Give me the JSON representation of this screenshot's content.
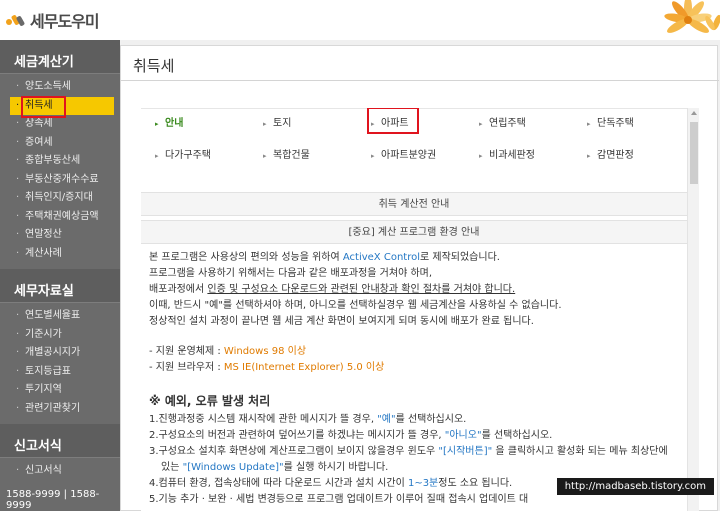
{
  "header": {
    "logo_text": "세무도우미"
  },
  "sidebar": {
    "sections": [
      {
        "title": "세금계산기",
        "items": [
          "양도소득세",
          "취득세",
          "상속세",
          "증여세",
          "종합부동산세",
          "부동산중개수수료",
          "취득인지/증지대",
          "주택채권예상금액",
          "연말정산",
          "계산사례"
        ]
      },
      {
        "title": "세무자료실",
        "items": [
          "연도별세율표",
          "기준시가",
          "개별공시지가",
          "토지등급표",
          "투기지역",
          "관련기관찾기"
        ]
      },
      {
        "title": "신고서식",
        "items": [
          "신고서식"
        ]
      }
    ],
    "phone": "1588-9999 | 1588-9999"
  },
  "main": {
    "title": "취득세",
    "tabs": {
      "row1": [
        "안내",
        "토지",
        "아파트",
        "연립주택",
        "단독주택"
      ],
      "row2": [
        "다가구주택",
        "복합건물",
        "아파트분양권",
        "비과세판정",
        "감면판정"
      ]
    },
    "section1": "취득 계산전 안내",
    "section2": "[중요] 계산 프로그램 환경 안내",
    "para": {
      "l1a": "본 프로그램은 사용상의 편의와 성능을 위하여 ",
      "l1b": "ActiveX Control",
      "l1c": "로 제작되었습니다.",
      "l2": "프로그램을 사용하기 위해서는 다음과 같은 배포과정을 거쳐야 하며,",
      "l3a": "배포과정에서 ",
      "l3b": "인증 및 구성요소 다운로드와 관련된 안내창과 확인 절차를 거쳐야 합니다.",
      "l4": "이때, 반드시 \"예\"를 선택하셔야 하며, 아니오를 선택하실경우 웹 세금계산을 사용하실 수 없습니다.",
      "l5": "정상적인 설치 과정이 끝나면 웹 세금 계산 화면이 보여지게 되며 동시에 배포가 완료 됩니다.",
      "os_label": "- 지원 운영체제 : ",
      "os_value": "Windows 98 이상",
      "br_label": "- 지원 브라우저 : ",
      "br_value": "MS IE(Internet Explorer) 5.0 이상"
    },
    "errors": {
      "title": "※ 예외, 오류 발생 처리",
      "e1a": "1.진행과정중 시스템 재시작에 관한 메시지가 뜰 경우, ",
      "e1b": "\"예\"",
      "e1c": "를 선택하십시오.",
      "e2a": "2.구성요소의 버전과 관련하여 덮어쓰기를 하겠냐는 메시지가 뜰 경우, ",
      "e2b": "\"아니오\"",
      "e2c": "를 선택하십시오.",
      "e3a": "3.구성요소 설치후 화면상에 계산프로그램이 보이지 않을경우 윈도우 ",
      "e3b": "\"[시작버튼]\"",
      "e3c": " 을 클릭하시고 활성화 되는 메뉴 최상단에",
      "e3d": "있는 ",
      "e3e": "\"[Windows Update]\"",
      "e3f": "를 실행 하시기 바랍니다.",
      "e4a": "4.컴퓨터 환경, 접속상태에 따라 다운로드 시간과 설치 시간이 ",
      "e4b": "1~3분",
      "e4c": "정도 소요 됩니다.",
      "e5": "5.기능 추가 · 보완 · 세법 변경등으로 프로그램 업데이트가 이루어 질때 접속시 업데이트 대"
    }
  },
  "watermark": "http://madbaseb.tistory.com"
}
